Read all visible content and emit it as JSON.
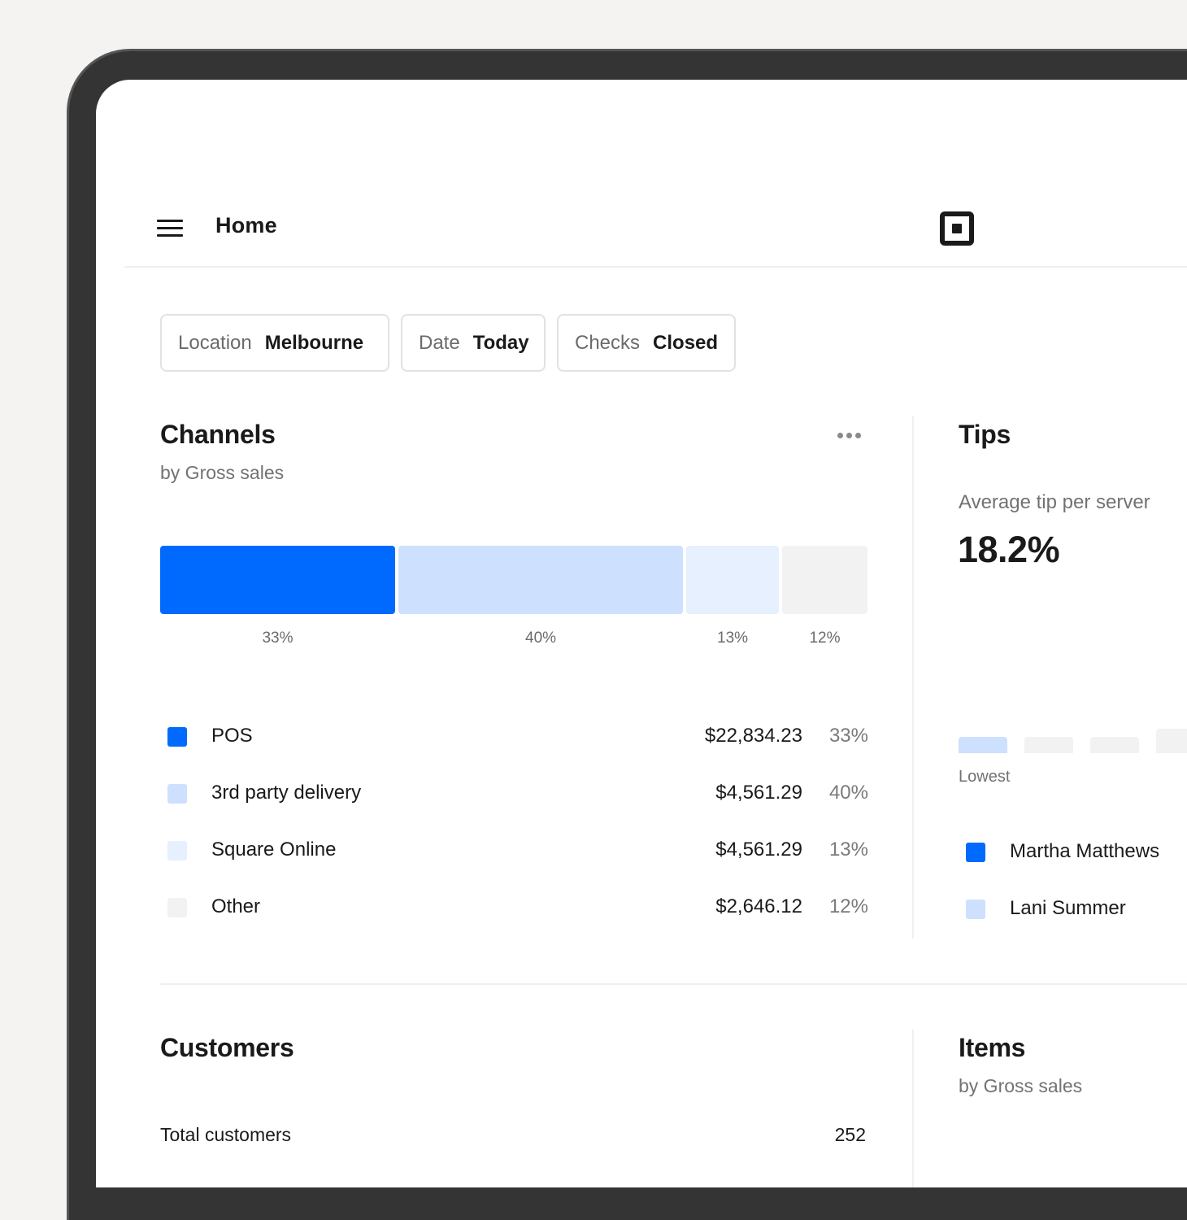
{
  "header": {
    "title": "Home",
    "menu_icon": "hamburger-menu-icon",
    "logo_icon": "square-logo-icon"
  },
  "filters": [
    {
      "key": "Location",
      "value": "Melbourne"
    },
    {
      "key": "Date",
      "value": "Today"
    },
    {
      "key": "Checks",
      "value": "Closed"
    }
  ],
  "channels": {
    "title": "Channels",
    "subtitle": "by Gross sales",
    "more_icon": "more-horizontal-icon",
    "chart_data": {
      "type": "bar",
      "orientation": "stacked-horizontal",
      "categories": [
        "POS",
        "3rd party delivery",
        "Square Online",
        "Other"
      ],
      "values": [
        33,
        40,
        13,
        12
      ],
      "labels": [
        "33%",
        "40%",
        "13%",
        "12%"
      ],
      "colors": [
        "#006aff",
        "#cde0fd",
        "#e6f0fe",
        "#f2f2f2"
      ]
    },
    "legend": [
      {
        "name": "POS",
        "amount": "$22,834.23",
        "pct": "33%",
        "color": "#006aff"
      },
      {
        "name": "3rd party delivery",
        "amount": "$4,561.29",
        "pct": "40%",
        "color": "#cde0fd"
      },
      {
        "name": "Square Online",
        "amount": "$4,561.29",
        "pct": "13%",
        "color": "#e6f0fe"
      },
      {
        "name": "Other",
        "amount": "$2,646.12",
        "pct": "12%",
        "color": "#f2f2f2"
      }
    ]
  },
  "tips": {
    "title": "Tips",
    "metric_label": "Average tip per server",
    "metric_value": "18.2%",
    "axis_label": "Lowest",
    "bar_colors": [
      "#cde0fd",
      "#f2f2f2",
      "#f2f2f2",
      "#f2f2f2"
    ],
    "servers": [
      {
        "name": "Martha Matthews",
        "color": "#006aff"
      },
      {
        "name": "Lani Summer",
        "color": "#cde0fd"
      }
    ]
  },
  "customers": {
    "title": "Customers",
    "total_label": "Total customers",
    "total_value": "252"
  },
  "items": {
    "title": "Items",
    "subtitle": "by Gross sales"
  }
}
